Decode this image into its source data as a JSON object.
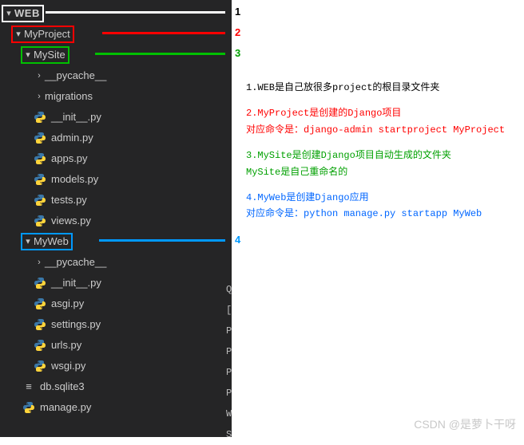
{
  "tree": {
    "root": "WEB",
    "project": "MyProject",
    "site": "MySite",
    "site_children": [
      {
        "kind": "folder",
        "name": "__pycache__"
      },
      {
        "kind": "folder",
        "name": "migrations"
      },
      {
        "kind": "py",
        "name": "__init__.py"
      },
      {
        "kind": "py",
        "name": "admin.py"
      },
      {
        "kind": "py",
        "name": "apps.py"
      },
      {
        "kind": "py",
        "name": "models.py"
      },
      {
        "kind": "py",
        "name": "tests.py"
      },
      {
        "kind": "py",
        "name": "views.py"
      }
    ],
    "web": "MyWeb",
    "web_children": [
      {
        "kind": "folder",
        "name": "__pycache__"
      },
      {
        "kind": "py",
        "name": "__init__.py"
      },
      {
        "kind": "py",
        "name": "asgi.py"
      },
      {
        "kind": "py",
        "name": "settings.py"
      },
      {
        "kind": "py",
        "name": "urls.py"
      },
      {
        "kind": "py",
        "name": "wsgi.py"
      }
    ],
    "project_children": [
      {
        "kind": "db",
        "name": "db.sqlite3"
      },
      {
        "kind": "py",
        "name": "manage.py"
      }
    ]
  },
  "markers": {
    "n1": "1",
    "n2": "2",
    "n3": "3",
    "n4": "4"
  },
  "notes": {
    "n1": "1.WEB是自己放很多project的根目录文件夹",
    "n2": "2.MyProject是创建的Django项目\n对应命令是：django-admin startproject MyProject",
    "n3": "3.MySite是创建Django项目自动生成的文件夹\nMySite是自己重命名的",
    "n4": "4.MyWeb是创建Django应用\n对应命令是：python manage.py startapp MyWeb"
  },
  "rcol": [
    "Q",
    "[",
    "P",
    "P",
    "P",
    "P",
    "W",
    "S"
  ],
  "watermark": "CSDN @是萝卜干呀"
}
